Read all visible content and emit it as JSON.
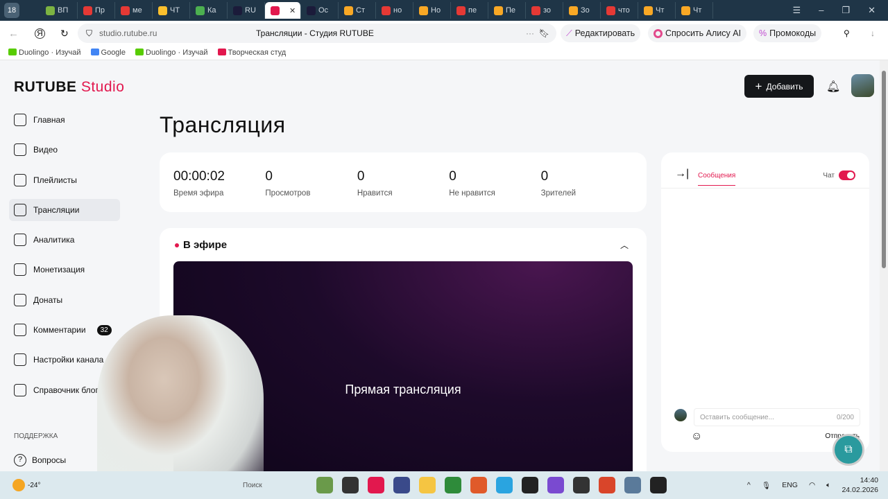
{
  "browser": {
    "tab_count": "18",
    "tabs": [
      {
        "label": "ВП",
        "color": "#7cb342"
      },
      {
        "label": "Пр",
        "color": "#e53935"
      },
      {
        "label": "ме",
        "color": "#e53935"
      },
      {
        "label": "ЧТ",
        "color": "#fbc02d"
      },
      {
        "label": "Ка",
        "color": "#4caf50"
      },
      {
        "label": "RU",
        "color": "#1b1b3a"
      },
      {
        "label": "",
        "color": "#e2184e",
        "active": true
      },
      {
        "label": "Ос",
        "color": "#1b1b3a"
      },
      {
        "label": "Ст",
        "color": "#f9a825"
      },
      {
        "label": "но",
        "color": "#e53935"
      },
      {
        "label": "Но",
        "color": "#f9a825"
      },
      {
        "label": "пе",
        "color": "#e53935"
      },
      {
        "label": "Пе",
        "color": "#f9a825"
      },
      {
        "label": "зо",
        "color": "#e53935"
      },
      {
        "label": "Зо",
        "color": "#f9a825"
      },
      {
        "label": "что",
        "color": "#e53935"
      },
      {
        "label": "Чт",
        "color": "#f9a825"
      },
      {
        "label": "Чт",
        "color": "#f9a825"
      }
    ],
    "url": "studio.rutube.ru",
    "page_title": "Трансляции - Студия RUTUBE",
    "edit_label": "Редактировать",
    "alice_label": "Спросить Алису AI",
    "promo_label": "Промокоды",
    "bookmarks": [
      {
        "label": "Duolingo · Изучай",
        "color": "#58cc02"
      },
      {
        "label": "Google",
        "color": "#4285f4"
      },
      {
        "label": "Duolingo · Изучай",
        "color": "#58cc02"
      },
      {
        "label": "Творческая студ",
        "color": "#e2184e"
      }
    ]
  },
  "app": {
    "logo_main": "RUTUBE",
    "logo_sub": "Studio",
    "add_label": "Добавить",
    "nav": [
      {
        "label": "Главная"
      },
      {
        "label": "Видео"
      },
      {
        "label": "Плейлисты"
      },
      {
        "label": "Трансляции",
        "active": true
      },
      {
        "label": "Аналитика"
      },
      {
        "label": "Монетизация"
      },
      {
        "label": "Донаты"
      },
      {
        "label": "Комментарии",
        "badge": "32"
      },
      {
        "label": "Настройки канала"
      },
      {
        "label": "Справочник блогера"
      }
    ],
    "support_heading": "ПОДДЕРЖКА",
    "help_label": "Вопросы",
    "page_heading": "Трансляция",
    "stats": [
      {
        "value": "00:00:02",
        "label": "Время эфира"
      },
      {
        "value": "0",
        "label": "Просмотров"
      },
      {
        "value": "0",
        "label": "Нравится"
      },
      {
        "value": "0",
        "label": "Не нравится"
      },
      {
        "value": "0",
        "label": "Зрителей"
      }
    ],
    "live_heading": "В эфире",
    "player_text": "Прямая трансляция",
    "chat": {
      "tab": "Сообщения",
      "toggle_label": "Чат",
      "toggle_on": true,
      "placeholder": "Оставить сообщение...",
      "counter": "0/200",
      "send": "Отправить"
    }
  },
  "taskbar": {
    "weather": "-24°",
    "search": "Поиск",
    "lang": "ENG",
    "time": "14:40",
    "date": "24.02.2026"
  }
}
